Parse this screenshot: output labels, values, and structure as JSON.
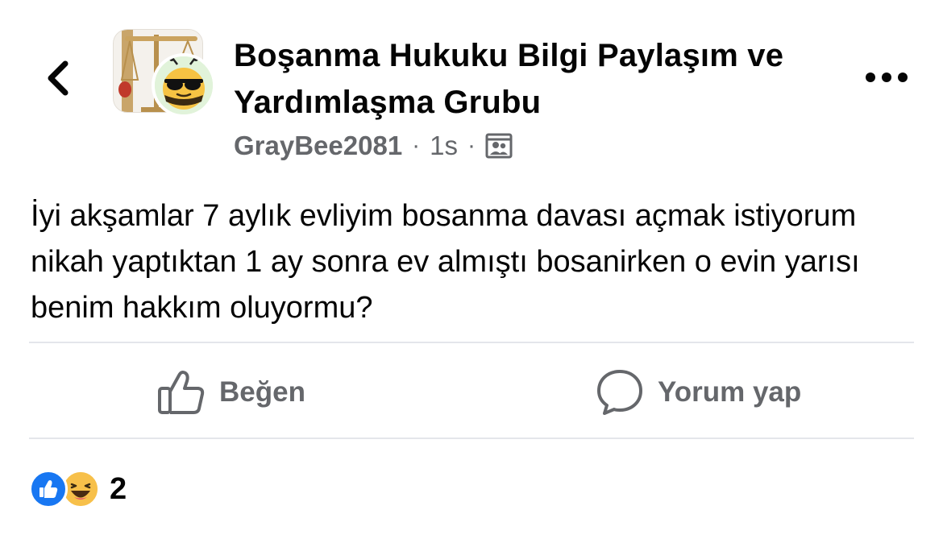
{
  "header": {
    "back_icon": "chevron-left-icon",
    "group_name": "Boşanma Hukuku Bilgi Paylaşım ve Yardımlaşma Grubu",
    "author": "GrayBee2081",
    "separator": "·",
    "time": "1s",
    "privacy_icon": "group-members-icon",
    "more_icon": "more-horizontal-icon"
  },
  "post": {
    "text": "İyi akşamlar 7 aylık evliyim bosanma davası açmak istiyorum nikah yaptıktan 1 ay sonra ev almıştı bosanirken o evin yarısı benim hakkım oluyormu?"
  },
  "actions": {
    "like_label": "Beğen",
    "comment_label": "Yorum yap"
  },
  "reactions": {
    "types": [
      "like",
      "haha"
    ],
    "count": "2"
  },
  "colors": {
    "text_primary": "#050505",
    "text_secondary": "#65676b",
    "divider": "#e4e6eb",
    "like_blue": "#1877f2",
    "haha_yellow": "#f7c04a"
  }
}
